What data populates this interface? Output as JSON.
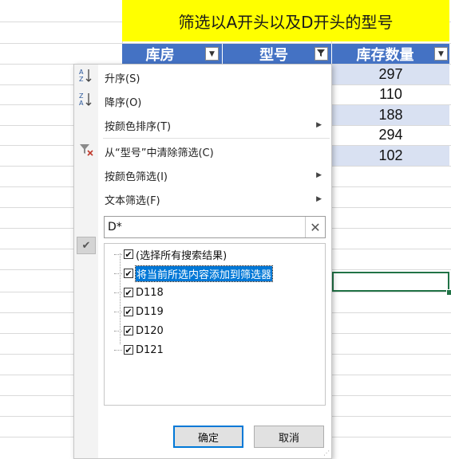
{
  "sheet": {
    "title": "筛选以A开头以及D开头的型号",
    "headers": [
      "库房",
      "型号",
      "库存数量"
    ],
    "quantities": [
      "297",
      "110",
      "188",
      "294",
      "102"
    ],
    "colors": {
      "header_bg": "#4472c4",
      "title_bg": "#ffff00",
      "band": "#d9e1f2",
      "selection": "#217346"
    }
  },
  "filter_menu": {
    "sort_asc": "升序(S)",
    "sort_desc": "降序(O)",
    "sort_by_color": "按颜色排序(T)",
    "clear_filter": "从“型号”中清除筛选(C)",
    "filter_by_color": "按颜色筛选(I)",
    "text_filter": "文本筛选(F)",
    "search_value": "D*",
    "list_items": [
      {
        "label": "(选择所有搜索结果)",
        "checked": true
      },
      {
        "label": "将当前所选内容添加到筛选器",
        "checked": true
      },
      {
        "label": "D118",
        "checked": true
      },
      {
        "label": "D119",
        "checked": true
      },
      {
        "label": "D120",
        "checked": true
      },
      {
        "label": "D121",
        "checked": true
      }
    ],
    "ok_label": "确定",
    "cancel_label": "取消"
  }
}
